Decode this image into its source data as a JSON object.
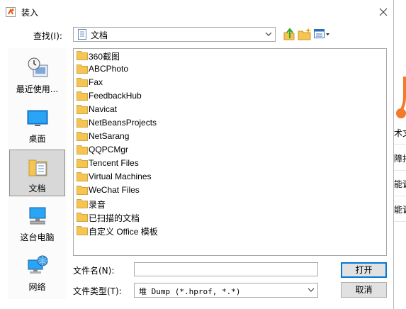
{
  "window": {
    "title": "装入"
  },
  "toolbar": {
    "look_in_label": "查找(I):",
    "look_in_value": "文档"
  },
  "places": [
    {
      "label": "最近使用...",
      "icon": "recent-places-icon"
    },
    {
      "label": "桌面",
      "icon": "desktop-icon"
    },
    {
      "label": "文档",
      "icon": "documents-icon",
      "selected": true
    },
    {
      "label": "这台电脑",
      "icon": "this-pc-icon"
    },
    {
      "label": "网络",
      "icon": "network-icon"
    }
  ],
  "files": [
    "360截图",
    "ABCPhoto",
    "Fax",
    "FeedbackHub",
    "Navicat",
    "NetBeansProjects",
    "NetSarang",
    "QQPCMgr",
    "Tencent Files",
    "Virtual Machines",
    "WeChat Files",
    "录音",
    "已扫描的文档",
    "自定义 Office 模板"
  ],
  "form": {
    "filename_label": "文件名(N):",
    "filename_value": "",
    "filetype_label": "文件类型(T):",
    "filetype_value": "堆 Dump (*.hprof, *.*)"
  },
  "buttons": {
    "open": "打开",
    "cancel": "取消"
  },
  "background_fragments": [
    "术文",
    "障排",
    "能调",
    "能调"
  ],
  "colors": {
    "folder": "#f5c451",
    "accent": "#0078d7",
    "selected_place": "#d8d8d8"
  }
}
